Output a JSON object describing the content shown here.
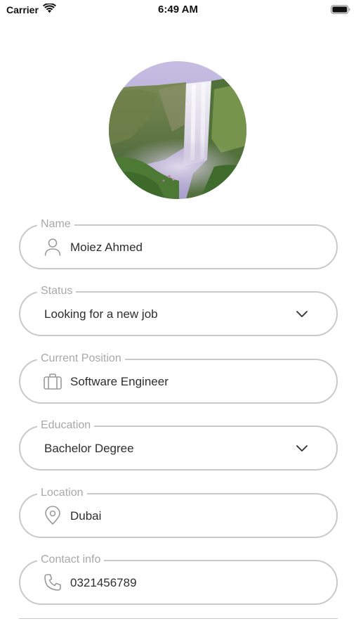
{
  "status_bar": {
    "carrier": "Carrier",
    "time": "6:49 AM",
    "wifi_icon": "wifi-icon",
    "battery_icon": "battery-icon"
  },
  "profile": {
    "avatar_image": "waterfall landscape"
  },
  "fields": {
    "name": {
      "label": "Name",
      "value": "Moiez Ahmed",
      "icon": "person-icon"
    },
    "status": {
      "label": "Status",
      "value": "Looking for a new job",
      "icon": "chevron-down-icon"
    },
    "current_position": {
      "label": "Current Position",
      "value": "Software Engineer",
      "icon": "briefcase-icon"
    },
    "education": {
      "label": "Education",
      "value": "Bachelor Degree",
      "icon": "chevron-down-icon"
    },
    "location": {
      "label": "Location",
      "value": "Dubai",
      "icon": "location-pin-icon"
    },
    "contact_info": {
      "label": "Contact info",
      "value": "0321456789",
      "icon": "phone-icon"
    }
  },
  "colors": {
    "border": "#c9c9c9",
    "label": "#a8a8a8",
    "text": "#2e2e2e",
    "icon": "#9a9a9a"
  }
}
